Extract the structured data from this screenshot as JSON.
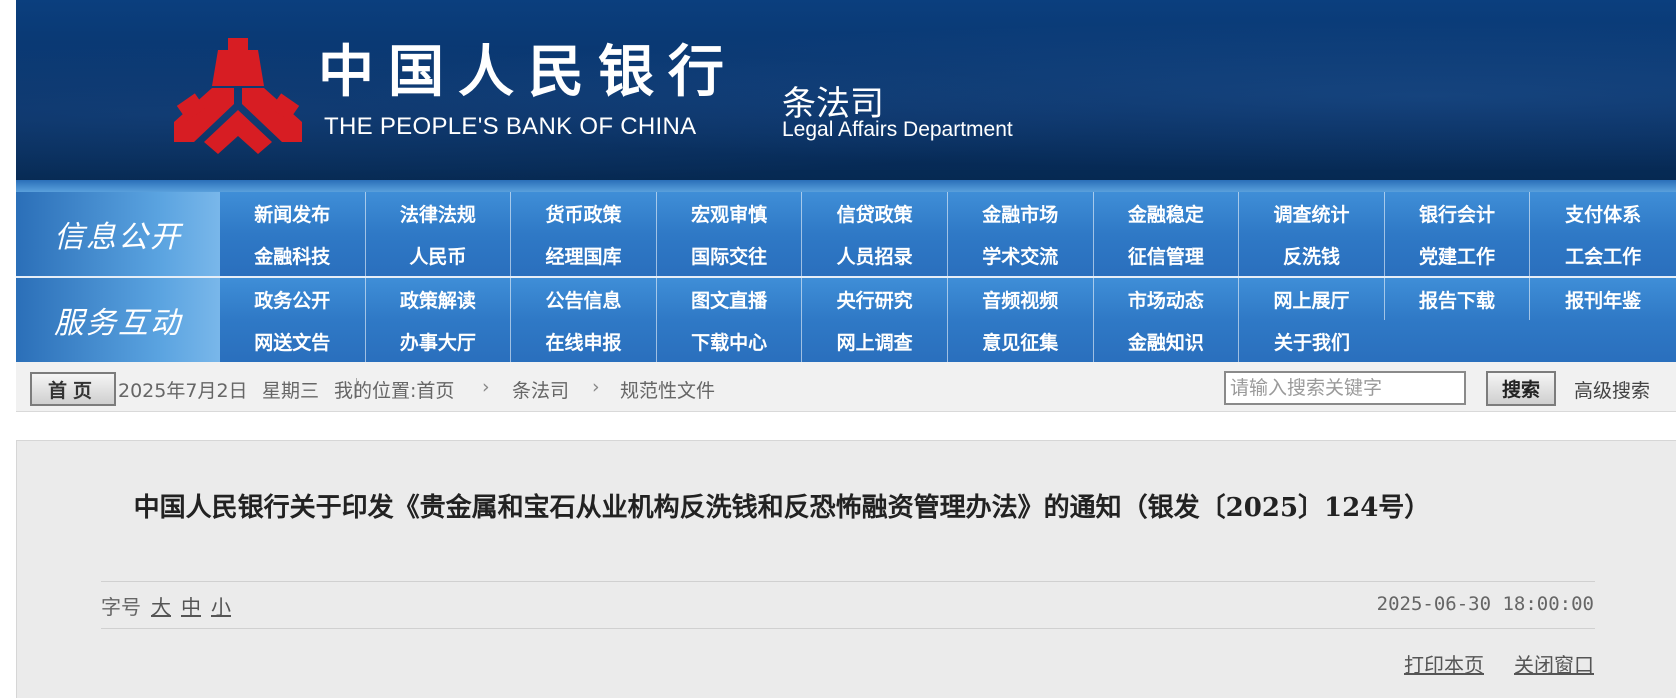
{
  "header": {
    "bank_name_cn": "中国人民银行",
    "bank_name_en": "THE PEOPLE'S BANK OF CHINA",
    "department_cn": "条法司",
    "department_en": "Legal Affairs Department",
    "logo_icon": "pboc-logo-icon",
    "banner_color": "#0b3f7e",
    "logo_color": "#d71d23"
  },
  "nav": {
    "info_label": "信息公开",
    "service_label": "服务互动",
    "info_row1": [
      "新闻发布",
      "法律法规",
      "货币政策",
      "宏观审慎",
      "信贷政策",
      "金融市场",
      "金融稳定",
      "调查统计",
      "银行会计",
      "支付体系"
    ],
    "info_row2": [
      "金融科技",
      "人民币",
      "经理国库",
      "国际交往",
      "人员招录",
      "学术交流",
      "征信管理",
      "反洗钱",
      "党建工作",
      "工会工作"
    ],
    "service_row1": [
      "政务公开",
      "政策解读",
      "公告信息",
      "图文直播",
      "央行研究",
      "音频视频",
      "市场动态",
      "网上展厅",
      "报告下载",
      "报刊年鉴"
    ],
    "service_row2": [
      "网送文告",
      "办事大厅",
      "在线申报",
      "下载中心",
      "网上调查",
      "意见征集",
      "金融知识",
      "关于我们"
    ],
    "accent_color": "#2f79c6"
  },
  "breadcrumb": {
    "home_label": "首页",
    "date": "2025年7月2日",
    "weekday": "星期三",
    "location_label": "我的位置:首页",
    "level2": "条法司",
    "level3": "规范性文件",
    "chevron": "›"
  },
  "search": {
    "placeholder": "请输入搜索关键字",
    "button_label": "搜索",
    "advanced_label": "高级搜索"
  },
  "article": {
    "title": "中国人民银行关于印发《贵金属和宝石从业机构反洗钱和反恐怖融资管理办法》的通知（银发〔2025〕124号）",
    "font_size_label": "字号",
    "font_large": "大",
    "font_medium": "中",
    "font_small": "小",
    "publish_time": "2025-06-30 18:00:00",
    "print_label": "打印本页",
    "close_label": "关闭窗口"
  }
}
